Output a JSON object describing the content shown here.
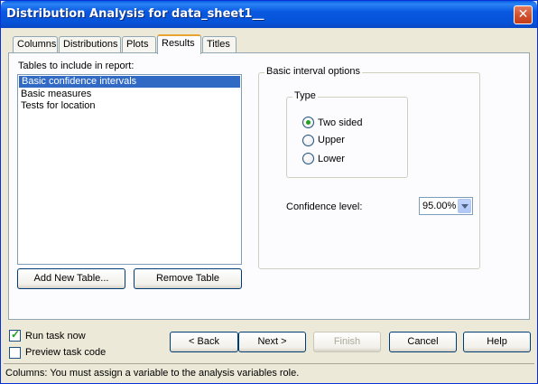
{
  "window": {
    "title": "Distribution Analysis for data_sheet1__",
    "close_symbol": "✕"
  },
  "tabs": [
    {
      "label": "Columns",
      "active": false
    },
    {
      "label": "Distributions",
      "active": false
    },
    {
      "label": "Plots",
      "active": false
    },
    {
      "label": "Results",
      "active": true
    },
    {
      "label": "Titles",
      "active": false
    }
  ],
  "results": {
    "tables_label": "Tables to include in report:",
    "tables": [
      {
        "label": "Basic confidence intervals",
        "selected": true
      },
      {
        "label": "Basic measures",
        "selected": false
      },
      {
        "label": "Tests for location",
        "selected": false
      }
    ],
    "add_table_label": "Add New Table...",
    "remove_table_label": "Remove Table",
    "interval_group_title": "Basic interval options",
    "type_group_title": "Type",
    "type_options": [
      {
        "label": "Two sided",
        "checked": true
      },
      {
        "label": "Upper",
        "checked": false
      },
      {
        "label": "Lower",
        "checked": false
      }
    ],
    "confidence_label": "Confidence level:",
    "confidence_value": "95.00%"
  },
  "footer": {
    "run_task_label": "Run task now",
    "run_task_checked": true,
    "preview_label": "Preview task code",
    "preview_checked": false,
    "back_label": "< Back",
    "next_label": "Next >",
    "finish_label": "Finish",
    "cancel_label": "Cancel",
    "help_label": "Help"
  },
  "status": {
    "text": "Columns: You must assign a variable to the analysis variables role."
  }
}
